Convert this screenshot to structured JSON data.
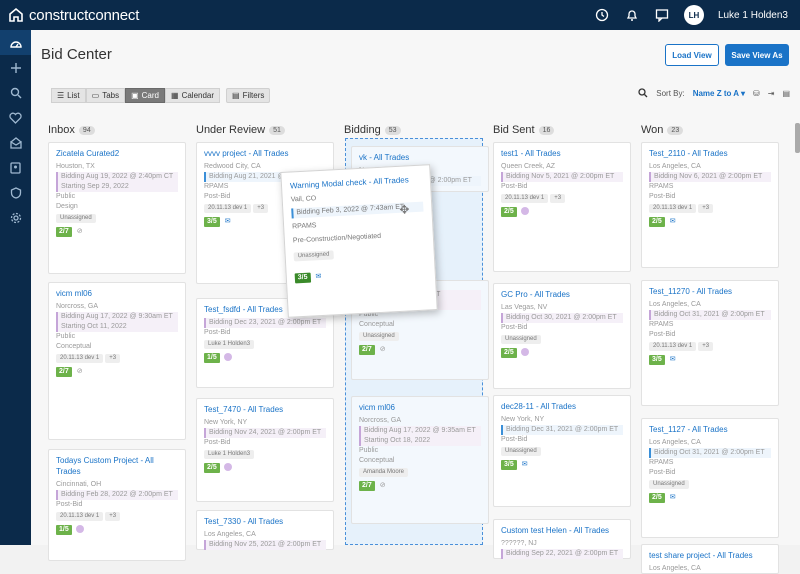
{
  "app": {
    "logo_text": "constructconnect",
    "user_initials": "LH",
    "user_name": "Luke 1 Holden3"
  },
  "page": {
    "title": "Bid Center",
    "load_view": "Load View",
    "save_view": "Save View As"
  },
  "viewbar": {
    "list": "List",
    "tabs": "Tabs",
    "card": "Card",
    "calendar": "Calendar",
    "filters": "Filters"
  },
  "sort": {
    "label": "Sort By:",
    "value": "Name Z to A"
  },
  "columns": [
    {
      "name": "Inbox",
      "count": "94"
    },
    {
      "name": "Under Review",
      "count": "51"
    },
    {
      "name": "Bidding",
      "count": "53"
    },
    {
      "name": "Bid Sent",
      "count": "16"
    },
    {
      "name": "Won",
      "count": "23"
    }
  ],
  "cards": {
    "inbox": [
      {
        "title": "Zicatela Curated2",
        "loc": "Houston, TX",
        "bidding": "Bidding Aug 19, 2022 @ 2:40pm CT",
        "starting": "Starting Sep 29, 2022",
        "l1": "Public",
        "l2": "Design",
        "pill": "Unassigned",
        "badge": "2/7"
      },
      {
        "title": "vicm ml06",
        "loc": "Norcross, GA",
        "bidding": "Bidding Aug 17, 2022 @ 9:30am ET",
        "starting": "Starting Oct 11, 2022",
        "l1": "Public",
        "l2": "Conceptual",
        "pill": "20.11.13 dev 1",
        "pill2": "+3",
        "badge": "2/7"
      },
      {
        "title": "Todays Custom Project - All Trades",
        "loc": "Cincinnati, OH",
        "bidding": "Bidding Feb 28, 2022 @ 2:00pm ET",
        "l1": "Post-Bid",
        "pill": "20.11.13 dev 1",
        "pill2": "+3",
        "badge": "1/5"
      }
    ],
    "review": [
      {
        "title": "vvvv project - All Trades",
        "loc": "Redwood City, CA",
        "bidding": "Bidding Aug 21, 2021 @ 2:00pm ET",
        "l1": "RPAMS",
        "l2": "Post-Bid",
        "pill": "20.11.13 dev 1",
        "pill2": "+3",
        "badge": "3/5"
      },
      {
        "title": "Test_fsdfd - All Trades",
        "loc": "Post-Bid",
        "bidding": "Bidding Dec 23, 2021 @ 2:00pm ET",
        "l1": "Post-Bid",
        "pill": "Luke 1 Holden3",
        "badge": "1/5"
      },
      {
        "title": "Test_7470 - All Trades",
        "loc": "New York, NY",
        "bidding": "Bidding Nov 24, 2021 @ 2:00pm ET",
        "l1": "Post-Bid",
        "pill": "Luke 1 Holden3",
        "badge": "2/5"
      },
      {
        "title": "Test_7330 - All Trades",
        "loc": "Los Angeles, CA",
        "bidding": "Bidding Nov 25, 2021 @ 2:00pm ET",
        "l1": "Post-Bid"
      }
    ],
    "bidding": [
      {
        "title": "vk - All Trades",
        "loc": "New York, NY",
        "bidding": "Bidding Feb 3, 2022 @ 2:00pm ET"
      },
      {
        "bidding": "Bidding ... @ 7:55am ET",
        "starting": "Starting Oct 20, 2022",
        "l1": "Public",
        "l2": "Conceptual",
        "pill": "Unassigned",
        "badge": "2/7"
      },
      {
        "title": "vicm ml06",
        "loc": "Norcross, GA",
        "bidding": "Bidding Aug 17, 2022 @ 9:35am ET",
        "starting": "Starting Oct 18, 2022",
        "l1": "Public",
        "l2": "Conceptual",
        "pill": "Amanda Moore",
        "badge": "2/7"
      }
    ],
    "sent": [
      {
        "title": "test1 - All Trades",
        "loc": "Queen Creek, AZ",
        "bidding": "Bidding Nov 5, 2021 @ 2:00pm ET",
        "l1": "Post-Bid",
        "pill": "20.11.13 dev 1",
        "pill2": "+3",
        "badge": "2/5"
      },
      {
        "title": "GC Pro - All Trades",
        "loc": "Las Vegas, NV",
        "bidding": "Bidding Oct 30, 2021 @ 2:00pm ET",
        "l1": "Post-Bid",
        "pill": "Unassigned",
        "badge": "2/5"
      },
      {
        "title": "dec28-11 - All Trades",
        "loc": "New York, NY",
        "bidding": "Bidding Dec 31, 2021 @ 2:00pm ET",
        "l1": "Post-Bid",
        "pill": "Unassigned",
        "badge": "3/5"
      },
      {
        "title": "Custom test Helen - All Trades",
        "loc": "??????, NJ",
        "bidding": "Bidding Sep 22, 2021 @ 2:00pm ET"
      }
    ],
    "won": [
      {
        "title": "Test_2110 - All Trades",
        "loc": "Los Angeles, CA",
        "bidding": "Bidding Nov 6, 2021 @ 2:00pm ET",
        "l1": "RPAMS",
        "l2": "Post-Bid",
        "pill": "20.11.13 dev 1",
        "pill2": "+3",
        "badge": "2/5"
      },
      {
        "title": "Test_11270 - All Trades",
        "loc": "Los Angeles, CA",
        "bidding": "Bidding Oct 31, 2021 @ 2:00pm ET",
        "l1": "RPAMS",
        "l2": "Post-Bid",
        "pill": "20.11.13 dev 1",
        "pill2": "+3",
        "badge": "3/5"
      },
      {
        "title": "Test_1127 - All Trades",
        "loc": "Los Angeles, CA",
        "bidding": "Bidding Oct 31, 2021 @ 2:00pm ET",
        "l1": "RPAMS",
        "l2": "Post-Bid",
        "pill": "Unassigned",
        "badge": "2/5"
      },
      {
        "title": "test share project - All Trades",
        "loc": "Los Angeles, CA"
      }
    ]
  },
  "modal": {
    "title": "Warning Modal check - All Trades",
    "loc": "Vail, CO",
    "bidding": "Bidding Feb 3, 2022 @ 7:43am ET",
    "l1": "RPAMS",
    "l2": "Pre-Construction/Negotiated",
    "pill": "Unassigned",
    "badge": "3/5"
  }
}
